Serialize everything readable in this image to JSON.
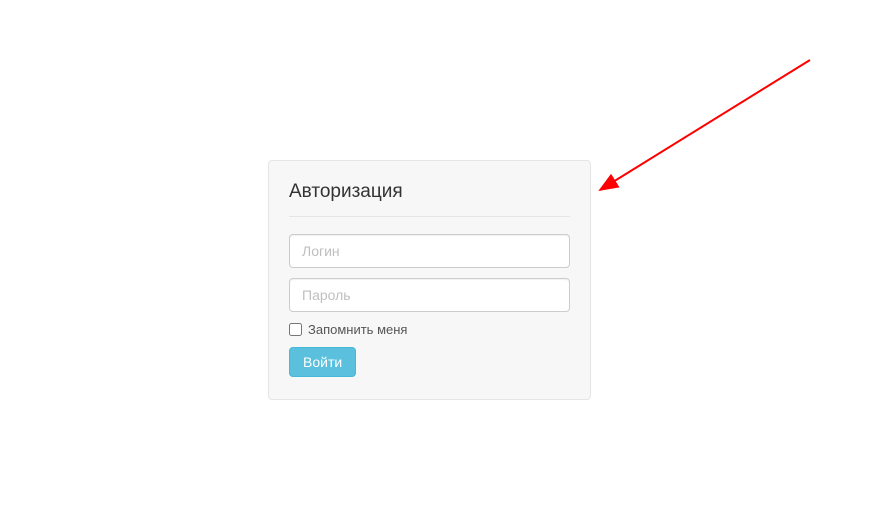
{
  "login": {
    "title": "Авторизация",
    "username_placeholder": "Логин",
    "password_placeholder": "Пароль",
    "remember_label": "Запомнить меня",
    "submit_label": "Войти"
  },
  "annotation": {
    "arrow_color": "#ff0000"
  }
}
